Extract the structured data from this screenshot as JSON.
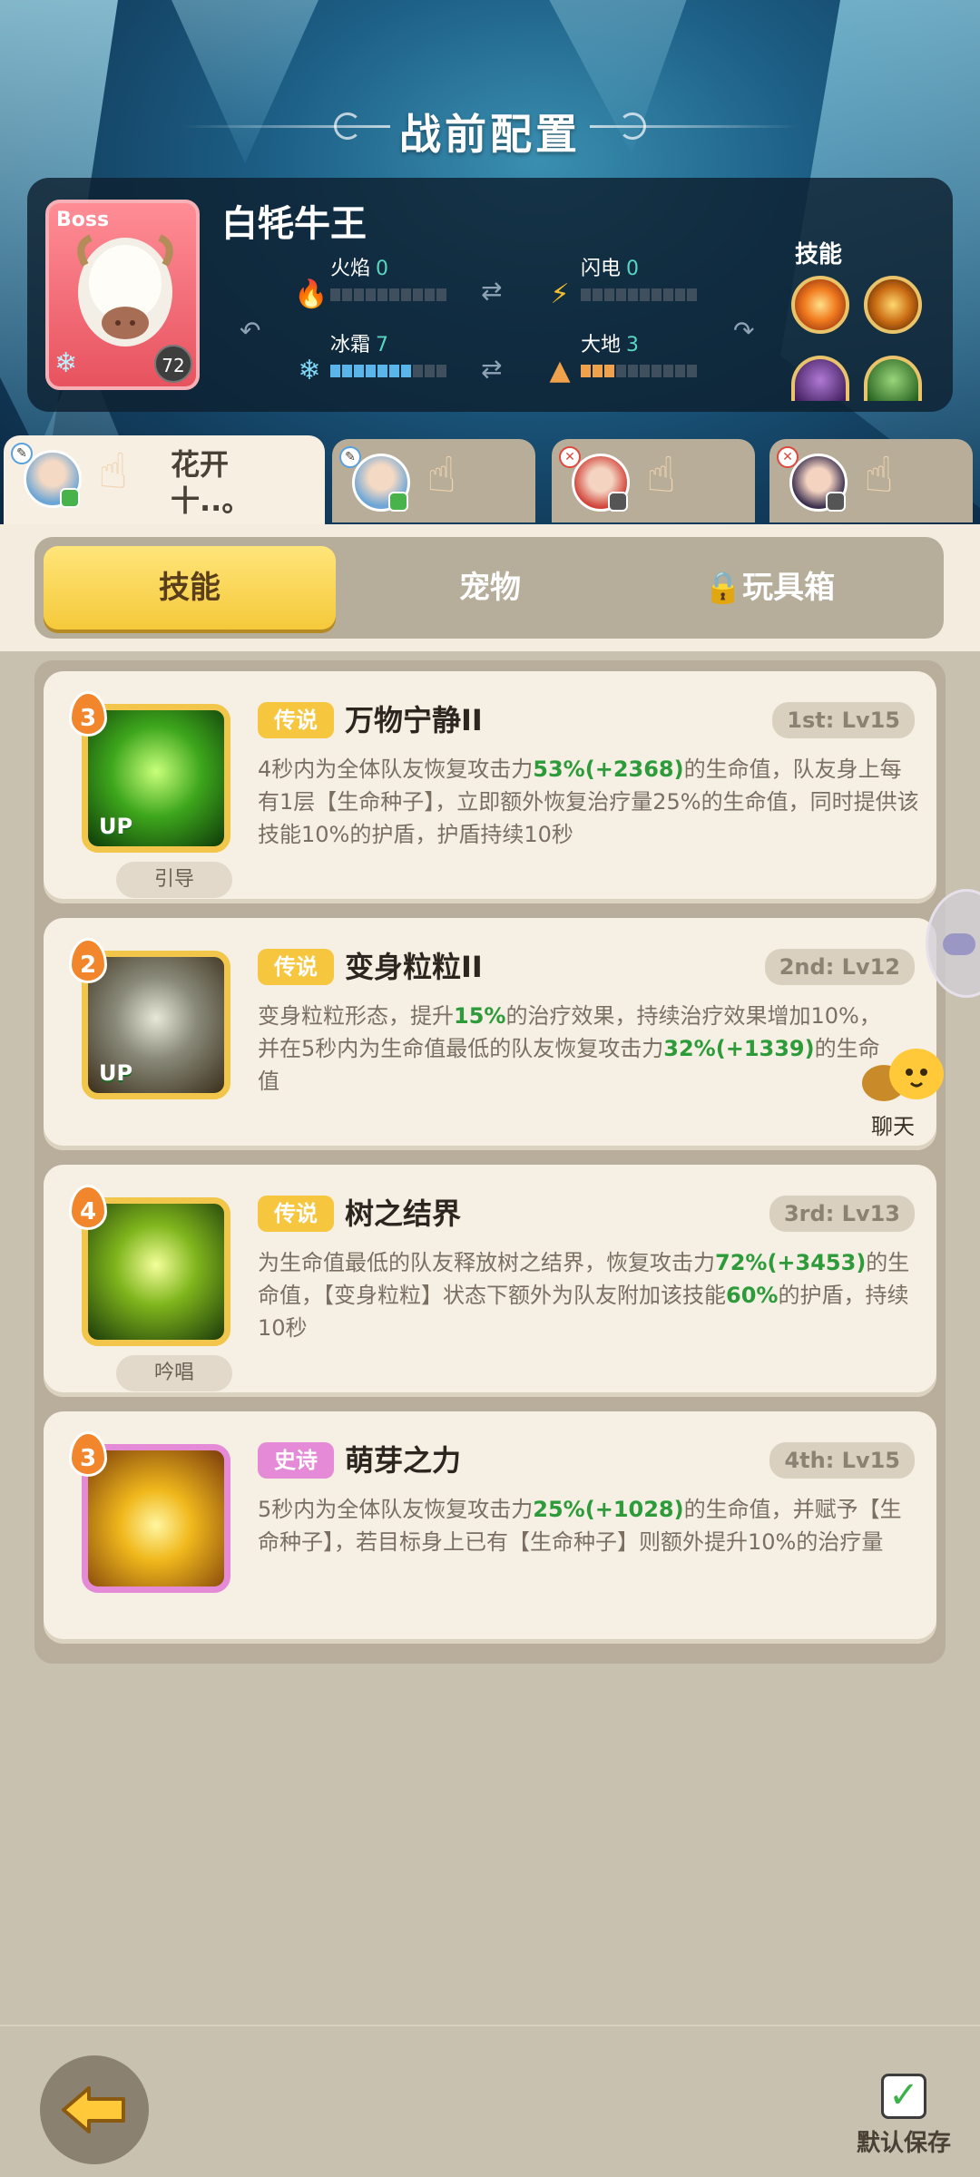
{
  "screen_title": "战前配置",
  "boss": {
    "tag": "Boss",
    "name": "白牦牛王",
    "level": "72",
    "elements": [
      {
        "label": "火焰",
        "value": "0",
        "icon": "fire-icon",
        "filled": 0
      },
      {
        "label": "闪电",
        "value": "0",
        "icon": "lightning-icon",
        "filled": 0
      },
      {
        "label": "冰霜",
        "value": "7",
        "icon": "snowflake-icon",
        "filled": 7
      },
      {
        "label": "大地",
        "value": "3",
        "icon": "earth-icon",
        "filled": 3
      }
    ],
    "skills_label": "技能"
  },
  "heroes": [
    {
      "name": "花开十..。",
      "active": true
    },
    {
      "name": "",
      "active": false
    },
    {
      "name": "",
      "active": false
    },
    {
      "name": "",
      "active": false
    }
  ],
  "tabs": {
    "skill": "技能",
    "pet": "宠物",
    "toybox": "玩具箱"
  },
  "skills": [
    {
      "rank": "3",
      "rarity": "传说",
      "name": "万物宁静II",
      "level": "1st: Lv15",
      "chip": "引导",
      "up": "UP",
      "desc": [
        "4秒内为全体队友恢复攻击力",
        "53%",
        "(+2368)",
        "的生命值，队友身上每有1层【生命种子】，立即额外恢复治疗量25%的生命值，同时提供该技能10%的护盾，护盾持续10秒"
      ]
    },
    {
      "rank": "2",
      "rarity": "传说",
      "name": "变身粒粒II",
      "level": "2nd: Lv12",
      "chip": "",
      "up": "UP",
      "desc": [
        "变身粒粒形态，提升",
        "15%",
        "的治疗效果，持续治疗效果增加10%，并在5秒内为生命值最低的队友恢复攻击力",
        "32%",
        "(+1339)",
        "的生命值"
      ]
    },
    {
      "rank": "4",
      "rarity": "传说",
      "name": "树之结界",
      "level": "3rd: Lv13",
      "chip": "吟唱",
      "up": "",
      "desc": [
        "为生命值最低的队友释放树之结界，恢复攻击力",
        "72%",
        "(+3453)",
        "的生命值，【变身粒粒】状态下额外为队友附加该技能",
        "60%",
        "的护盾，持续10秒"
      ]
    },
    {
      "rank": "3",
      "rarity": "史诗",
      "name": "萌芽之力",
      "level": "4th: Lv15",
      "chip": "",
      "up": "",
      "desc": [
        "5秒内为全体队友恢复攻击力",
        "25%",
        "(+1028)",
        "的生命值，并赋予【生命种子】，若目标身上已有【生命种子】则额外提升10%的治疗量"
      ]
    }
  ],
  "chat_label": "聊天",
  "default_save_label": "默认保存",
  "colors": {
    "accent_yellow": "#f5c93a",
    "legend": "#f5c63e",
    "epic": "#e58ad6",
    "value_green": "#2d9b3a"
  }
}
